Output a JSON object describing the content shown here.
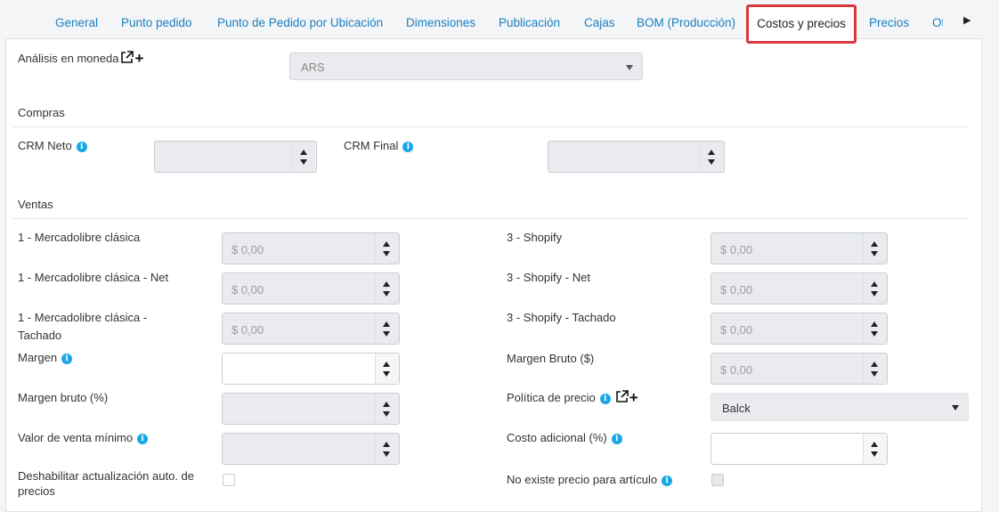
{
  "tabs": [
    {
      "label": "General"
    },
    {
      "label": "Punto pedido"
    },
    {
      "label": "Punto de Pedido por Ubicación"
    },
    {
      "label": "Dimensiones"
    },
    {
      "label": "Publicación"
    },
    {
      "label": "Cajas"
    },
    {
      "label": "BOM (Producción)"
    },
    {
      "label": "Costos y precios"
    },
    {
      "label": "Precios"
    },
    {
      "label": "Ot"
    }
  ],
  "moneda": {
    "label": "Análisis en moneda",
    "value": "ARS"
  },
  "compras": {
    "title": "Compras",
    "crm_neto": {
      "label": "CRM Neto",
      "value": ""
    },
    "crm_final": {
      "label": "CRM Final",
      "value": ""
    }
  },
  "ventas": {
    "title": "Ventas",
    "ml_clasica": {
      "label": "1 - Mercadolibre clásica",
      "value": "$ 0,00"
    },
    "ml_clasica_net": {
      "label": "1 - Mercadolibre clásica - Net",
      "value": "$ 0,00"
    },
    "ml_clasica_tachado": {
      "label": "1 - Mercadolibre clásica - Tachado",
      "value": "$ 0,00"
    },
    "margen": {
      "label": "Margen",
      "value": ""
    },
    "margen_bruto_pct": {
      "label": "Margen bruto (%)",
      "value": ""
    },
    "valor_venta_minimo": {
      "label": "Valor de venta mínimo",
      "value": ""
    },
    "deshabilitar": {
      "label": "Deshabilitar actualización auto. de precios",
      "checked": false
    },
    "shopify": {
      "label": "3 - Shopify",
      "value": "$ 0,00"
    },
    "shopify_net": {
      "label": "3 - Shopify - Net",
      "value": "$ 0,00"
    },
    "shopify_tachado": {
      "label": "3 - Shopify - Tachado",
      "value": "$ 0,00"
    },
    "margen_bruto_abs": {
      "label": "Margen Bruto ($)",
      "value": "$ 0,00"
    },
    "politica_precio": {
      "label": "Política de precio",
      "value": "Balck"
    },
    "costo_adicional": {
      "label": "Costo adicional (%)",
      "value": ""
    },
    "no_existe_precio": {
      "label": "No existe precio para artículo",
      "checked": false
    }
  },
  "icons": {
    "info": "info-icon",
    "external": "external-link-icon",
    "add": "plus-icon",
    "scroll": "scroll-right-icon"
  }
}
